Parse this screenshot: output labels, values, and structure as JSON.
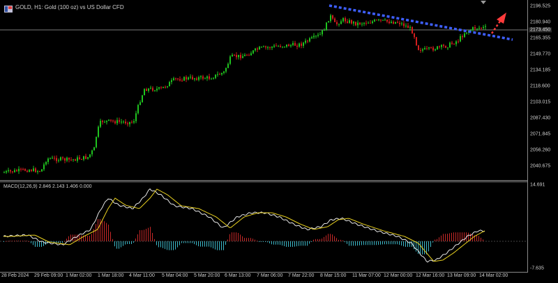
{
  "header": {
    "title": "GOLD, H1:  Gold (100 oz) vs US Dollar CFD",
    "icon": "chart-window-icon"
  },
  "price_axis": {
    "labels": [
      "2196.525",
      "2180.940",
      "2173.450",
      "2165.355",
      "2149.770",
      "2134.185",
      "2118.600",
      "2103.015",
      "2087.430",
      "2071.845",
      "2056.260",
      "2040.675"
    ],
    "current_price": "2173.450"
  },
  "macd": {
    "label": "MACD(12,26,9) 2.846 2.143 1.406 0.000",
    "axis": {
      "top": "14.691",
      "bottom": "-7.635"
    }
  },
  "time_axis": {
    "labels": [
      "28 Feb 2024",
      "29 Feb 09:00",
      "1 Mar 02:00",
      "1 Mar 18:00",
      "4 Mar 11:00",
      "5 Mar 04:00",
      "5 Mar 20:00",
      "6 Mar 13:00",
      "7 Mar 06:00",
      "7 Mar 22:00",
      "8 Mar 15:00",
      "11 Mar 07:00",
      "12 Mar 00:00",
      "12 Mar 16:00",
      "13 Mar 09:00",
      "14 Mar 02:00"
    ]
  },
  "colors": {
    "bull": "#1fc21f",
    "bear": "#d11e1e",
    "trendline": "#3e5fff",
    "arrow": "#ff3b3b",
    "macd_line": "#e8e8e8",
    "signal_line": "#e8d020",
    "hist_pos": "#c82828",
    "hist_neg": "#3cb8c8"
  },
  "chart_data": {
    "type": "candlestick",
    "symbol": "GOLD",
    "timeframe": "H1",
    "ylim": [
      2031,
      2200
    ],
    "annotations": [
      "descending trendline",
      "breakout arrow"
    ]
  }
}
